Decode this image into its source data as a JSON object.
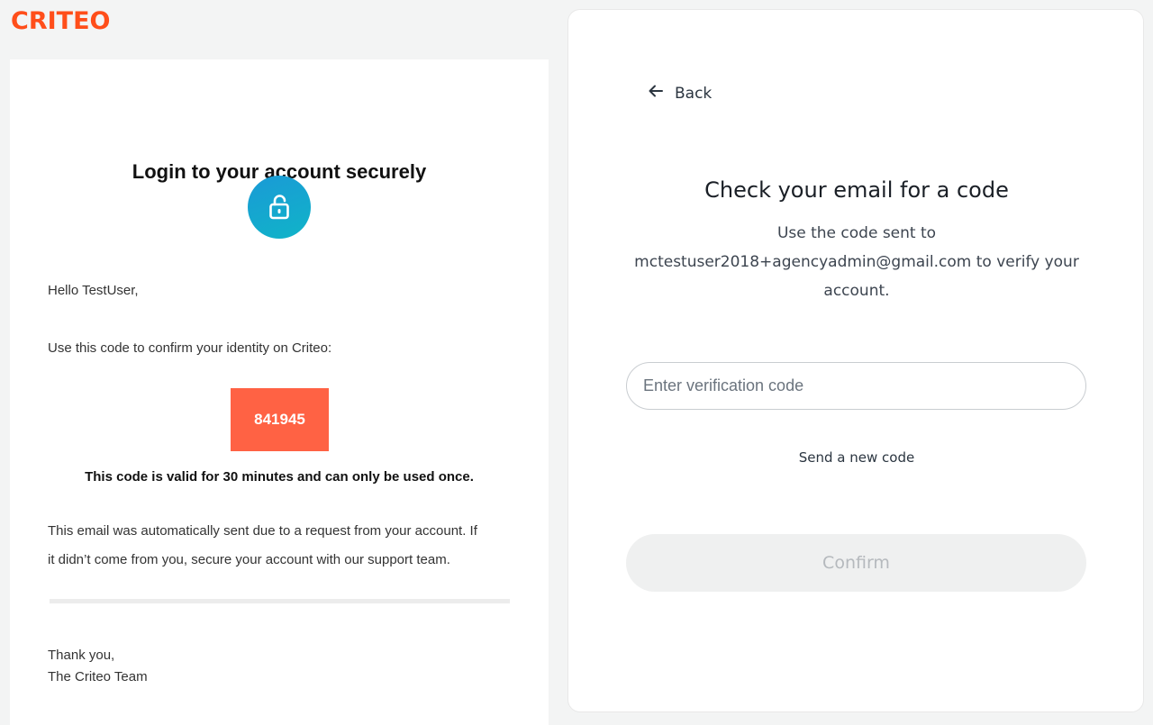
{
  "brand": {
    "logo_text": "CRITEO",
    "accent_color": "#ff4e1a"
  },
  "email": {
    "title": "Login to your account securely",
    "icon": "lock-open-icon",
    "greeting": "Hello TestUser,",
    "instruction": "Use this code to confirm your identity on Criteo:",
    "code": "841945",
    "validity": "This code is valid for 30 minutes and can only be used once.",
    "notice_line1": "This email was automatically sent due to a request from your account. If",
    "notice_line2": "it didn’t come from you, secure your account with our support team.",
    "signoff_line1": "Thank you,",
    "signoff_line2": "The Criteo Team"
  },
  "verify": {
    "back_label": "Back",
    "title": "Check your email for a code",
    "desc_line1": "Use the code sent to",
    "desc_line2": "mctestuser2018+agencyadmin@gmail.com to verify your",
    "desc_line3": "account.",
    "input_placeholder": "Enter verification code",
    "input_value": "",
    "send_new_label": "Send a new code",
    "confirm_label": "Confirm"
  }
}
